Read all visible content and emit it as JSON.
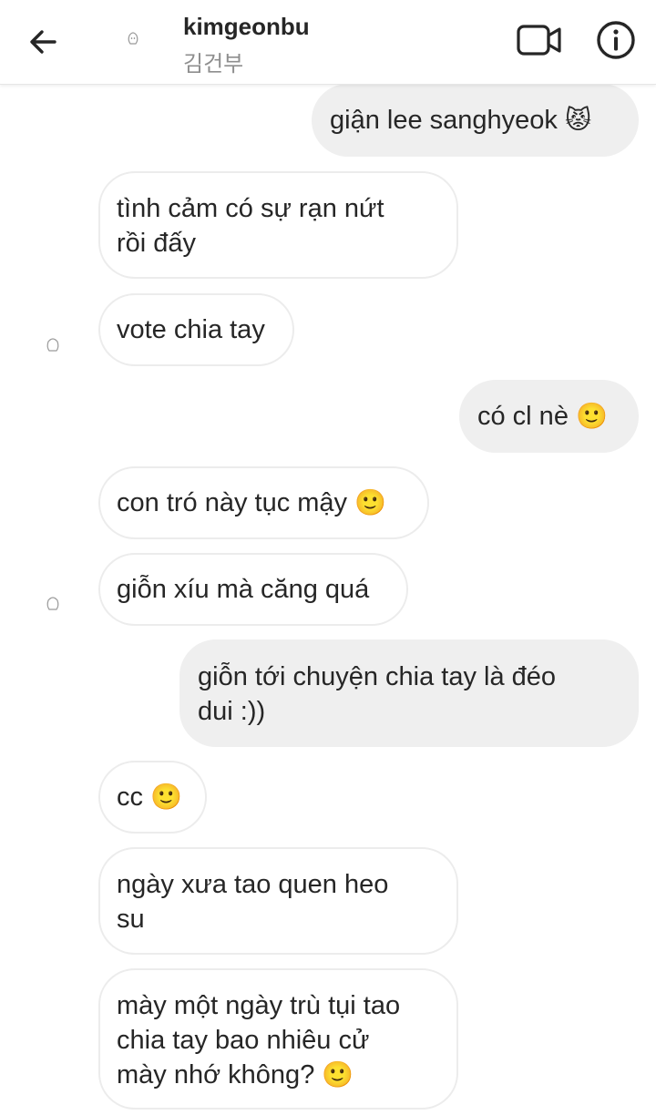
{
  "header": {
    "username": "kimgeonbu",
    "subtitle": "김건부"
  },
  "messages": [
    {
      "dir": "out",
      "text": "giận lee sanghyeok",
      "emoji": "😾"
    },
    {
      "dir": "in",
      "text": "tình cảm có sự rạn nứt\nrồi đấy",
      "emoji": ""
    },
    {
      "dir": "in",
      "text": "vote chia tay",
      "emoji": ""
    },
    {
      "dir": "out",
      "text": "có cl nè",
      "emoji": "🙂"
    },
    {
      "dir": "in",
      "text": "con tró này tục mậy",
      "emoji": "🙂"
    },
    {
      "dir": "in",
      "text": "giỗn xíu mà căng quá",
      "emoji": ""
    },
    {
      "dir": "out",
      "text": "giỗn tới chuyện chia tay là đéo\ndui :))",
      "emoji": ""
    },
    {
      "dir": "in",
      "text": "cc",
      "emoji": "🙂"
    },
    {
      "dir": "in",
      "text": "ngày xưa tao quen heo\nsu",
      "emoji": ""
    },
    {
      "dir": "in",
      "text": "mày một ngày trù tụi tao\nchia tay bao nhiêu cử\nmày nhớ không?",
      "emoji": "🙂"
    }
  ]
}
